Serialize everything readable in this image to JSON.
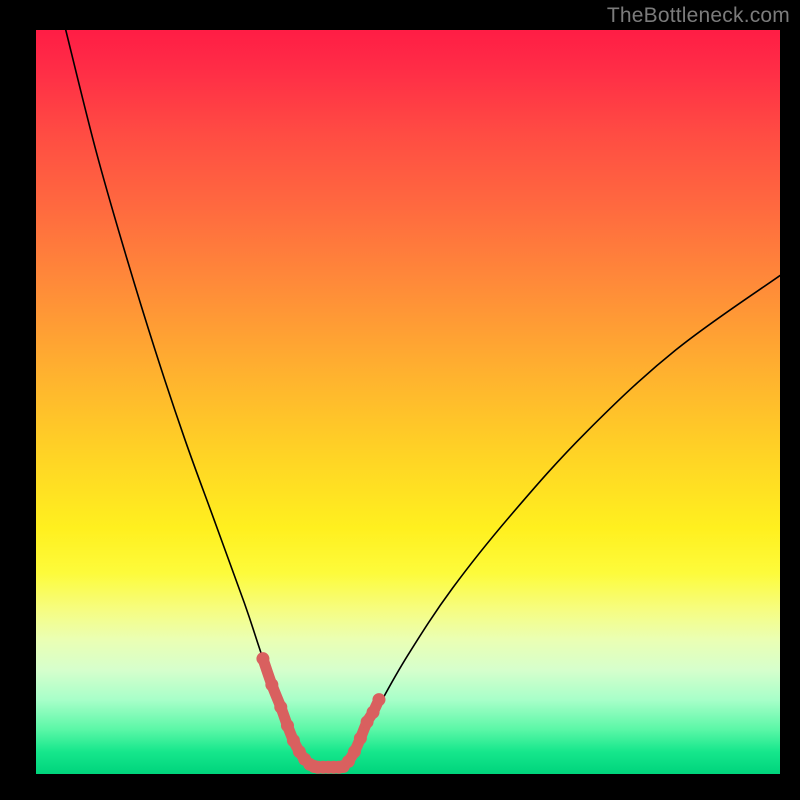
{
  "watermark": "TheBottleneck.com",
  "chart_data": {
    "type": "line",
    "title": "",
    "xlabel": "",
    "ylabel": "",
    "xlim": [
      0,
      100
    ],
    "ylim": [
      0,
      100
    ],
    "grid": false,
    "legend": false,
    "series": [
      {
        "name": "left-curve",
        "color": "#000000",
        "x": [
          4,
          8,
          12,
          16,
          20,
          24,
          28,
          30,
          32,
          33,
          34,
          35,
          36,
          37
        ],
        "y": [
          100,
          84,
          70,
          57,
          45,
          34,
          23,
          17,
          11,
          8,
          5,
          3,
          1.5,
          1
        ]
      },
      {
        "name": "right-curve",
        "color": "#000000",
        "x": [
          41,
          42,
          43,
          44,
          46,
          50,
          56,
          64,
          74,
          86,
          100
        ],
        "y": [
          1,
          1.5,
          3,
          5,
          9,
          16,
          25,
          35,
          46,
          57,
          67
        ]
      },
      {
        "name": "bottom-markers-left",
        "color": "#d9605f",
        "marker": "round",
        "x": [
          30.5,
          31.7,
          32.9,
          33.8,
          34.6,
          35.4,
          36.1,
          36.8,
          37.4
        ],
        "y": [
          15.5,
          12.0,
          9.0,
          6.5,
          4.5,
          3.0,
          2.0,
          1.3,
          1.0
        ]
      },
      {
        "name": "bottom-markers-floor",
        "color": "#d9605f",
        "marker": "round",
        "x": [
          37.9,
          38.6,
          39.3,
          40.0,
          40.7,
          41.3
        ],
        "y": [
          0.9,
          0.9,
          0.9,
          0.9,
          0.9,
          1.0
        ]
      },
      {
        "name": "bottom-markers-right",
        "color": "#d9605f",
        "marker": "round",
        "x": [
          42.0,
          42.8,
          43.6,
          44.5,
          45.3,
          46.1
        ],
        "y": [
          1.7,
          3.0,
          4.8,
          7.0,
          8.3,
          10.0
        ]
      }
    ],
    "gradient_stops": [
      {
        "pos": 0.0,
        "color": "#ff1d45"
      },
      {
        "pos": 0.3,
        "color": "#ff7a3c"
      },
      {
        "pos": 0.6,
        "color": "#ffe221"
      },
      {
        "pos": 0.8,
        "color": "#f0ffa0"
      },
      {
        "pos": 1.0,
        "color": "#00d47c"
      }
    ]
  }
}
